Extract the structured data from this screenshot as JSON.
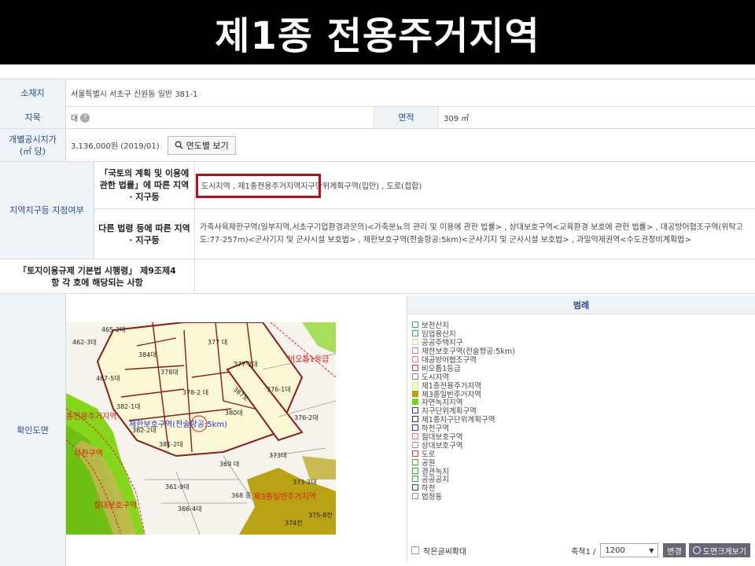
{
  "banner": {
    "title": "제1종 전용주거지역"
  },
  "rows": {
    "location": {
      "label": "소재지",
      "value": "서울특별시 서초구 신원동 일반 381-1"
    },
    "land": {
      "label": "지목",
      "value": "대",
      "help": "?",
      "area_label": "면적",
      "area_value": "309 ㎡"
    },
    "price": {
      "label": "개별공시지가(㎡ 당)",
      "value": "3,136,000원 (2019/01)",
      "button": "연도별 보기"
    },
    "zone": {
      "label": "지역지구등 지정여부",
      "sub1": "「국토의 계획 및 이용에 관한 법률」에 따른 지역 · 지구등",
      "value1_highlight": "도시지역 , 제1종전용주거지역",
      "value1_rest": " 지구단위계획구역(입안) , 도로(접합)",
      "sub2": "다른 법령 등에 따른 지역 · 지구등",
      "value2": "가축사육제한구역(일부지역,서초구기업환경과문의)<가축분뇨의 관리 및 이용에 관한 법률> , 상대보호구역<교육환경 보호에 관한 법률> , 대공방어협조구역(위탁고도:77-257m)<군사기지 및 군사시설 보호법> , 제한보호구역(전술항공:5km)<군사기지 및 군사시설 보호법> , 과밀억제권역<수도권정비계획법>"
    },
    "regulation": {
      "label": "「토지이용규제 기본법 시행령」 제9조제4항 각 호에 해당되는 사항"
    },
    "map": {
      "label": "확인도면"
    }
  },
  "map_labels": {
    "lots": [
      "465-2대",
      "462-3대",
      "384대",
      "377 대",
      "377-2대",
      "467-5대",
      "378대",
      "378-2 대",
      "376-1대",
      "382-1대",
      "380대",
      "376-2대",
      "382-2대",
      "381-2대",
      "373대",
      "369 대",
      "361-9대",
      "368 종",
      "373-2대",
      "366-4대",
      "375-8전",
      "374전",
      "387도"
    ],
    "zones": [
      "비오톱1등급",
      "제한보호구역(전술항공:5km)",
      "종전용주거지역",
      "하천구역",
      "절대보호구역",
      "제3종일반주거지역"
    ]
  },
  "legend": {
    "title": "범례",
    "items": [
      {
        "label": "보전산지",
        "color": "#ffffff",
        "border": "#3a7"
      },
      {
        "label": "임업용산지",
        "color": "#ffffff",
        "border": "#3a7"
      },
      {
        "label": "공공주택지구",
        "color": "#ffffff",
        "border": "#dd8"
      },
      {
        "label": "제한보호구역(전술항공:5km)",
        "color": "#ffffff",
        "border": "#d7a"
      },
      {
        "label": "대공방어협조구역",
        "color": "#ffffff",
        "border": "#d7a"
      },
      {
        "label": "비오톱1등급",
        "color": "#ffffff",
        "border": "#e33"
      },
      {
        "label": "도시지역",
        "color": "#ffffff",
        "border": "#88a"
      },
      {
        "label": "제1종전용주거지역",
        "color": "#fbf7c2",
        "border": "#dd9"
      },
      {
        "label": "제3종일반주거지역",
        "color": "#b7a012",
        "border": "#b7a012"
      },
      {
        "label": "자연녹지지역",
        "color": "#7cd317",
        "border": "#7cd317"
      },
      {
        "label": "지구단위계획구역",
        "color": "#ffffff",
        "border": "#33c"
      },
      {
        "label": "제1종지구단위계획구역",
        "color": "#ffffff",
        "border": "#333"
      },
      {
        "label": "하천구역",
        "color": "#ffffff",
        "border": "#33c"
      },
      {
        "label": "절대보호구역",
        "color": "#ffffff",
        "border": "#d7a"
      },
      {
        "label": "상대보호구역",
        "color": "#ffffff",
        "border": "#d7a"
      },
      {
        "label": "도로",
        "color": "#ffffff",
        "border": "#e33"
      },
      {
        "label": "공원",
        "color": "#ffffff",
        "border": "#3a3"
      },
      {
        "label": "경관녹지",
        "color": "#ffffff",
        "border": "#3a3"
      },
      {
        "label": "공공공지",
        "color": "#ffffff",
        "border": "#3a3"
      },
      {
        "label": "하천",
        "color": "#ffffff",
        "border": "#33c"
      },
      {
        "label": "법정동",
        "color": "#ffffff",
        "border": "#999"
      }
    ]
  },
  "footer": {
    "checkbox": "작은글씨확대",
    "scale_label": "축척1 /",
    "scale_value": "1200",
    "change": "변경",
    "zoom": "도면크게보기"
  }
}
